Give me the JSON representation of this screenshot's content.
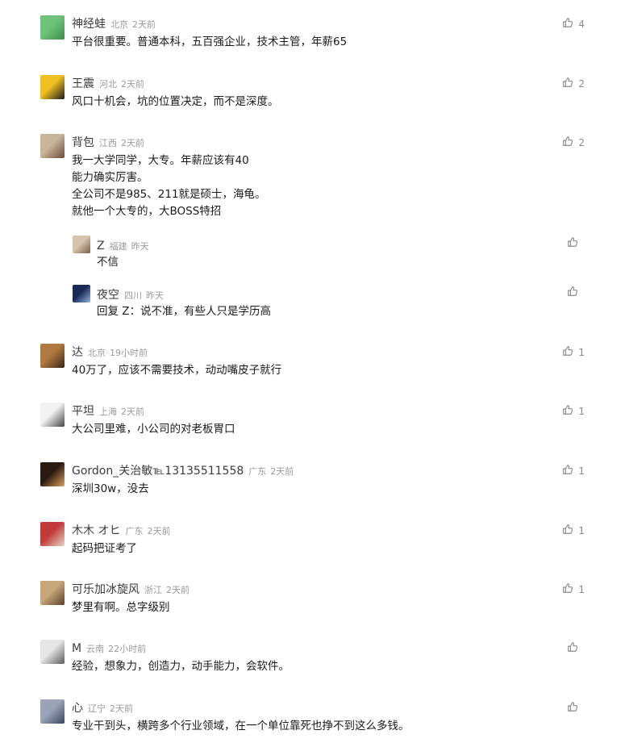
{
  "comments": [
    {
      "name": "神经蛙",
      "location": "北京",
      "time": "2天前",
      "likes": "4",
      "lines": [
        "平台很重要。普通本科，五百强企业，技术主管，年薪65"
      ],
      "avatar_colors": [
        "#6fc27a",
        "#3d8c47"
      ]
    },
    {
      "name": "王震",
      "location": "河北",
      "time": "2天前",
      "likes": "2",
      "lines": [
        "风口十机会，坑的位置决定，而不是深度。"
      ],
      "avatar_colors": [
        "#f0c020",
        "#1a1a1a"
      ]
    },
    {
      "name": "背包",
      "location": "江西",
      "time": "2天前",
      "likes": "2",
      "lines": [
        "我一大学同学，大专。年薪应该有40",
        "能力确实厉害。",
        "全公司不是985、211就是硕士，海龟。",
        "就他一个大专的，大BOSS特招"
      ],
      "avatar_colors": [
        "#c9b59a",
        "#6b4a3a"
      ],
      "replies": [
        {
          "name": "Z",
          "location": "福建",
          "time": "昨天",
          "likes": "",
          "lines": [
            "不信"
          ],
          "avatar_colors": [
            "#d8c3ae",
            "#7a5b46"
          ]
        },
        {
          "name": "夜空",
          "location": "四川",
          "time": "昨天",
          "likes": "",
          "lines": [
            "回复 Z：说不准，有些人只是学历高"
          ],
          "avatar_colors": [
            "#1b2a55",
            "#8fb3e0"
          ]
        }
      ]
    },
    {
      "name": "达",
      "location": "北京",
      "time": "19小时前",
      "likes": "1",
      "lines": [
        "40万了，应该不需要技术，动动嘴皮子就行"
      ],
      "avatar_colors": [
        "#b0793f",
        "#3a2614"
      ]
    },
    {
      "name": "平坦",
      "location": "上海",
      "time": "2天前",
      "likes": "1",
      "lines": [
        "大公司里难，小公司的对老板胃口"
      ],
      "avatar_colors": [
        "#f2f2f2",
        "#444444"
      ]
    },
    {
      "name": "Gordon_关治敏℡13135511558",
      "location": "广东",
      "time": "2天前",
      "likes": "1",
      "lines": [
        "深圳30w，没去"
      ],
      "avatar_colors": [
        "#2a1a12",
        "#d9a25c"
      ]
    },
    {
      "name": "木木 オヒ",
      "location": "广东",
      "time": "2天前",
      "likes": "1",
      "lines": [
        "起码把证考了"
      ],
      "avatar_colors": [
        "#c23a3a",
        "#e8d6c4"
      ]
    },
    {
      "name": "可乐加冰旋风",
      "location": "浙江",
      "time": "2天前",
      "likes": "1",
      "lines": [
        "梦里有啊。总字级别"
      ],
      "avatar_colors": [
        "#c7a67a",
        "#5c4128"
      ]
    },
    {
      "name": "M",
      "location": "云南",
      "time": "22小时前",
      "likes": "",
      "lines": [
        "经验，想象力，创造力，动手能力，会软件。"
      ],
      "avatar_colors": [
        "#e6e6e6",
        "#5a5a5a"
      ]
    },
    {
      "name": "心",
      "location": "辽宁",
      "time": "2天前",
      "likes": "",
      "lines": [
        "专业干到头，横跨多个行业领域，在一个单位靠死也挣不到这么多钱。"
      ],
      "avatar_colors": [
        "#9aa3b8",
        "#3d4660"
      ]
    }
  ]
}
